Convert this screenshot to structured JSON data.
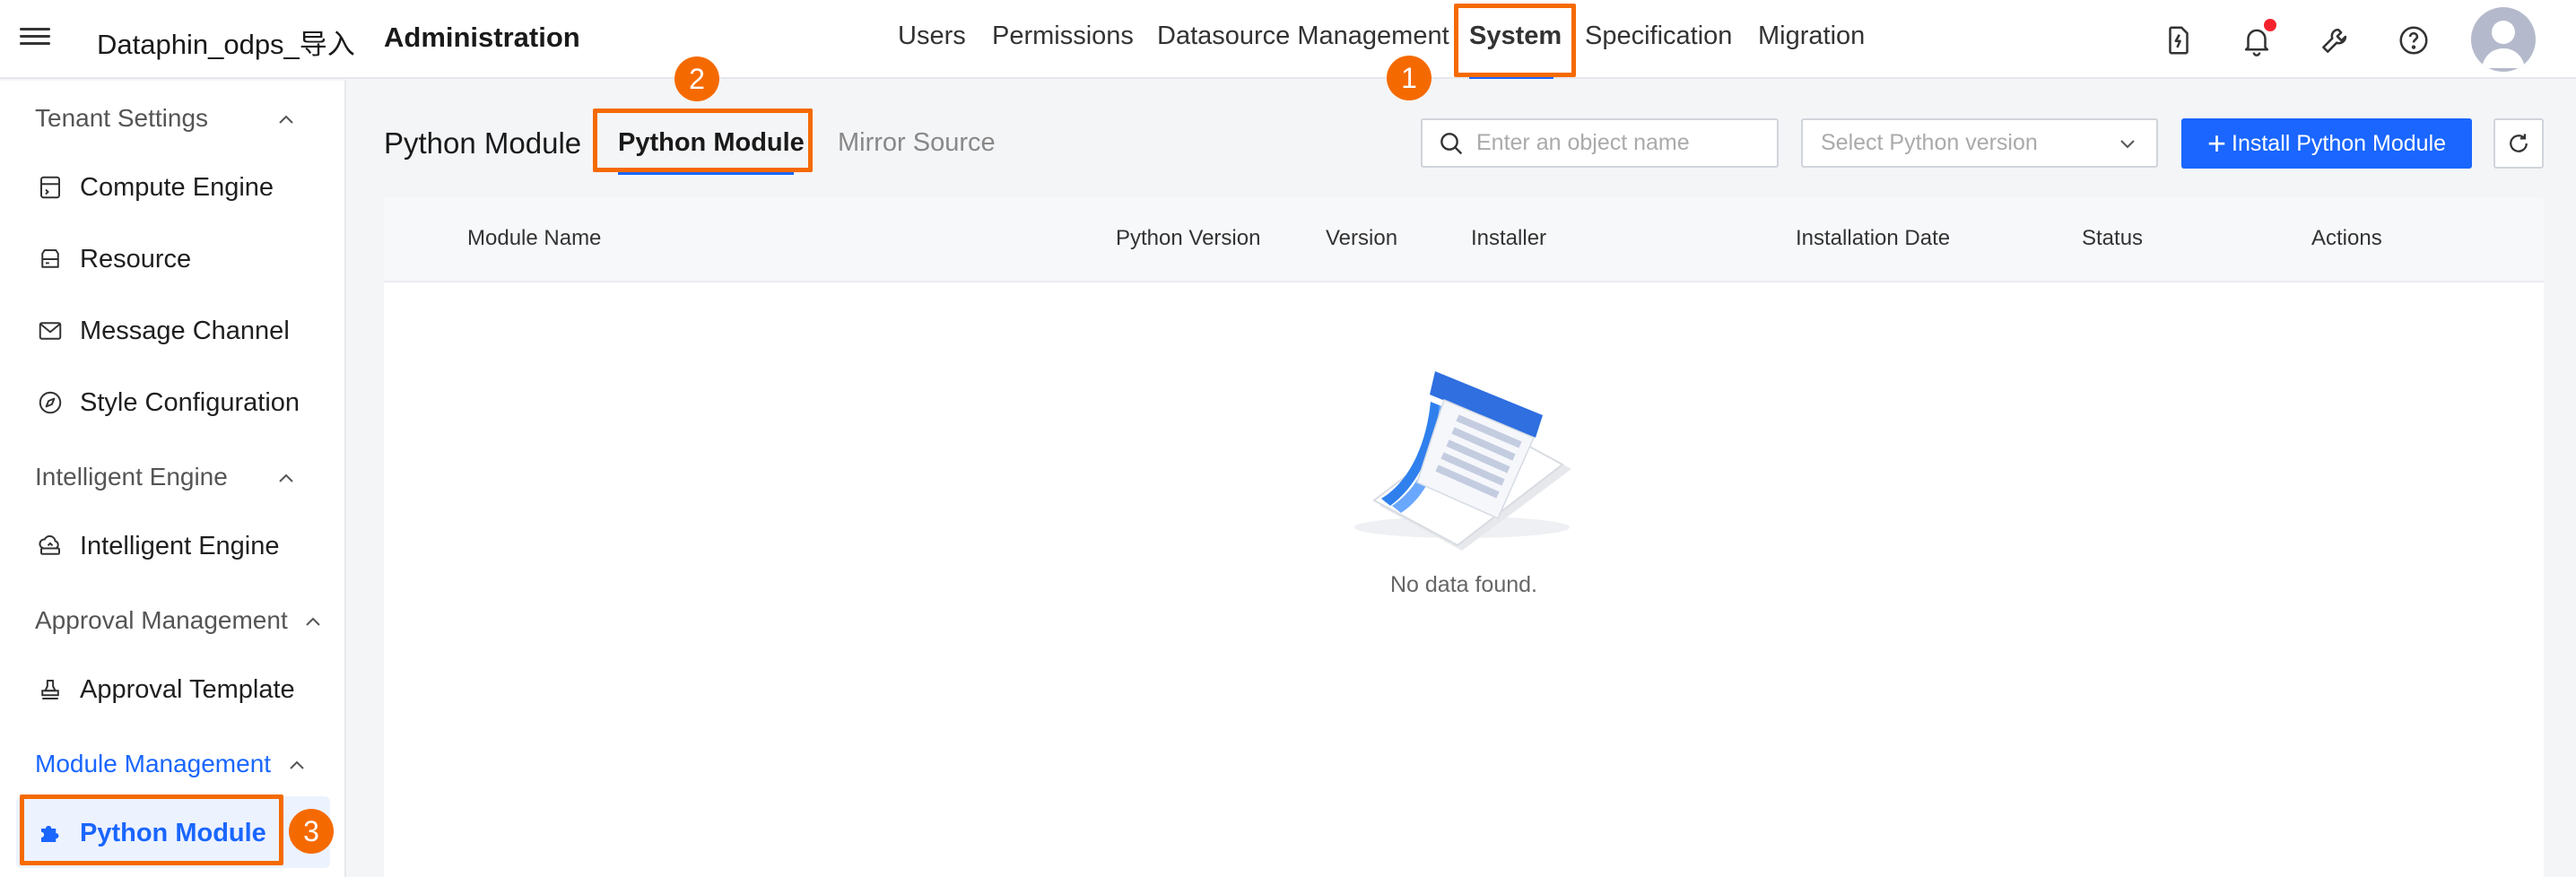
{
  "header": {
    "app_name": "Dataphin_odps_导入",
    "section": "Administration",
    "nav": [
      "Users",
      "Permissions",
      "Datasource Management",
      "System",
      "Specification",
      "Migration"
    ],
    "active_nav": "System",
    "icons": [
      "flash-doc-icon",
      "bell-icon",
      "wrench-icon",
      "help-icon",
      "avatar"
    ]
  },
  "sidebar": {
    "groups": [
      {
        "label": "Tenant Settings",
        "items": [
          "Compute Engine",
          "Resource",
          "Message Channel",
          "Style Configuration"
        ]
      },
      {
        "label": "Intelligent Engine",
        "items": [
          "Intelligent Engine"
        ]
      },
      {
        "label": "Approval Management",
        "items": [
          "Approval Template"
        ]
      },
      {
        "label": "Module Management",
        "items": [
          "Python Module"
        ]
      }
    ],
    "selected": "Python Module"
  },
  "main": {
    "title": "Python Module",
    "tabs": [
      "Python Module",
      "Mirror Source"
    ],
    "active_tab": "Python Module",
    "search_placeholder": "Enter an object name",
    "version_select_placeholder": "Select Python version",
    "install_button": "Install Python Module",
    "columns": [
      "Module Name",
      "Python Version",
      "Version",
      "Installer",
      "Installation Date",
      "Status",
      "Actions"
    ],
    "rows": [],
    "empty_text": "No data found."
  },
  "annotations": [
    "1",
    "2",
    "3"
  ],
  "colors": {
    "accent": "#1a66ff",
    "highlight": "#f56a00",
    "notification": "#f5222d"
  }
}
